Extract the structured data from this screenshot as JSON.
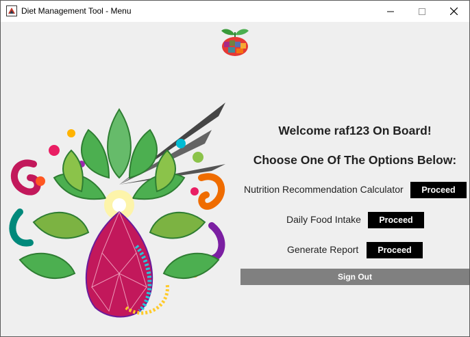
{
  "window": {
    "title": "Diet Management Tool - Menu",
    "controls": {
      "minimize_icon": "minimize-icon",
      "maximize_icon": "maximize-icon",
      "close_icon": "close-icon"
    }
  },
  "main": {
    "welcome": "Welcome raf123 On Board!",
    "choose": "Choose One Of The Options Below:",
    "options": [
      {
        "label": "Nutrition Recommendation Calculator",
        "button": "Proceed"
      },
      {
        "label": "Daily Food Intake",
        "button": "Proceed"
      },
      {
        "label": "Generate Report",
        "button": "Proceed"
      }
    ],
    "sign_out": "Sign Out"
  },
  "colors": {
    "button_bg": "#000000",
    "signout_bg": "#808080",
    "window_bg": "#efefef"
  }
}
